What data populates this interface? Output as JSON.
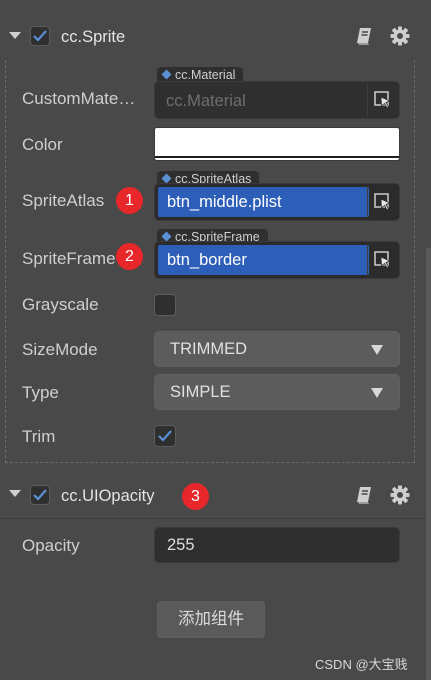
{
  "sprite": {
    "title": "cc.Sprite",
    "enabled": true,
    "properties": {
      "custom_material_label": "CustomMate…",
      "custom_material_tag": "cc.Material",
      "custom_material_value": "cc.Material",
      "color_label": "Color",
      "color_value": "#ffffff",
      "sprite_atlas_label": "SpriteAtlas",
      "sprite_atlas_tag": "cc.SpriteAtlas",
      "sprite_atlas_value": "btn_middle.plist",
      "sprite_frame_label": "SpriteFrame",
      "sprite_frame_tag": "cc.SpriteFrame",
      "sprite_frame_value": "btn_border",
      "grayscale_label": "Grayscale",
      "grayscale_checked": false,
      "size_mode_label": "SizeMode",
      "size_mode_value": "TRIMMED",
      "type_label": "Type",
      "type_value": "SIMPLE",
      "trim_label": "Trim",
      "trim_checked": true
    }
  },
  "ui_opacity": {
    "title": "cc.UIOpacity",
    "enabled": true,
    "opacity_label": "Opacity",
    "opacity_value": "255"
  },
  "badges": [
    "1",
    "2",
    "3"
  ],
  "add_component_label": "添加组件",
  "watermark": "CSDN @大宝贱",
  "icons": [
    "caret-down-icon",
    "checkbox-icon",
    "book-icon",
    "gear-icon",
    "asset-picker-icon",
    "dropdown-arrow-icon",
    "check-icon"
  ],
  "colors": {
    "panel_bg": "#494949",
    "accent_blue": "#2e5fb8",
    "badge_red": "#e8272b",
    "field_bg": "#2f2f2f"
  }
}
